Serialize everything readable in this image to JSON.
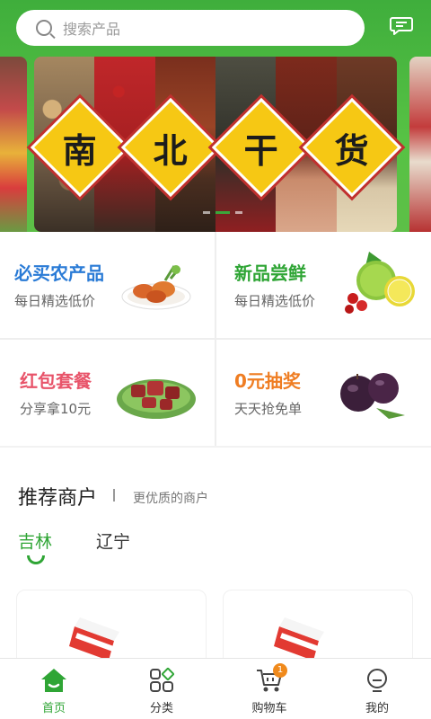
{
  "search": {
    "placeholder": "搜索产品"
  },
  "banner": {
    "chars": [
      "南",
      "北",
      "干",
      "货"
    ]
  },
  "promos": [
    {
      "title": "必买农产品",
      "subtitle": "每日精选低价",
      "color": "#2a7bd6",
      "image": "crab-plate-icon"
    },
    {
      "title": "新品尝鲜",
      "subtitle": "每日精选低价",
      "color": "#2fa535",
      "image": "citrus-fruit-icon"
    },
    {
      "title": "红包套餐",
      "subtitle": "分享拿10元",
      "color": "#e8546a",
      "image": "meat-plate-icon"
    },
    {
      "title": "0元抽奖",
      "subtitle": "天天抢免单",
      "color": "#ef7d22",
      "image": "plums-icon"
    }
  ],
  "merchants": {
    "title": "推荐商户",
    "subtitle": "更优质的商户",
    "tabs": [
      "吉林",
      "辽宁"
    ],
    "active_tab": "吉林"
  },
  "nav": {
    "items": [
      {
        "label": "首页",
        "icon": "home-icon",
        "active": true
      },
      {
        "label": "分类",
        "icon": "category-icon",
        "active": false
      },
      {
        "label": "购物车",
        "icon": "cart-icon",
        "active": false,
        "badge": "1"
      },
      {
        "label": "我的",
        "icon": "profile-icon",
        "active": false
      }
    ]
  },
  "colors": {
    "brand_green": "#2fa535",
    "header_green": "#4cb83f",
    "badge_orange": "#f08a1c"
  }
}
